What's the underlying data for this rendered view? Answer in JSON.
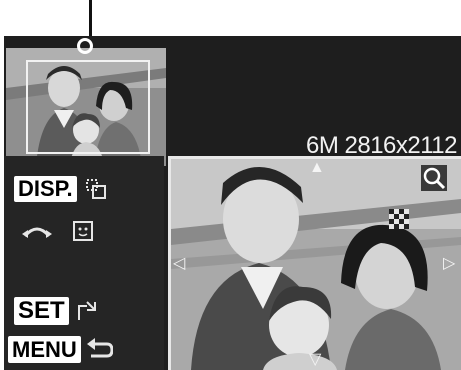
{
  "thumbnail": {
    "resolution": "6M 2816x2112"
  },
  "controls": {
    "disp": {
      "label": "DISP."
    },
    "set": {
      "label": "SET"
    },
    "menu": {
      "label": "MENU"
    }
  },
  "icons": {
    "pointer": "leader-line-icon",
    "zoom": "magnifier-icon",
    "face": "face-detect-icon",
    "rotate": "rotate-icon",
    "frame": "frame-switch-icon"
  },
  "arrows": {
    "up": "▲",
    "down": "▽",
    "left": "◁",
    "right": "▷"
  }
}
